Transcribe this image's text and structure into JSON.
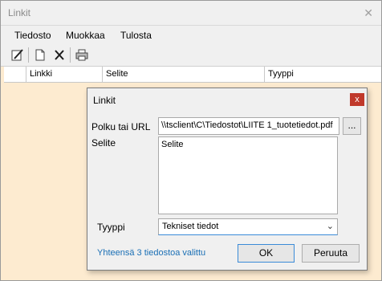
{
  "window": {
    "title": "Linkit",
    "close_glyph": "✕"
  },
  "menu": {
    "items": [
      "Tiedosto",
      "Muokkaa",
      "Tulosta"
    ]
  },
  "toolbar": {
    "icons": [
      "edit-icon",
      "new-document-icon",
      "delete-icon",
      "print-icon"
    ]
  },
  "grid": {
    "columns": [
      "Linkki",
      "Selite",
      "Tyyppi"
    ]
  },
  "dialog": {
    "title": "Linkit",
    "close_glyph": "x",
    "path_label": "Polku tai URL",
    "path_value": "\\\\tsclient\\C\\Tiedostot\\LIITE 1_tuotetiedot.pdf",
    "browse_label": "...",
    "desc_label": "Selite",
    "desc_value": "Selite",
    "type_label": "Tyyppi",
    "type_value": "Tekniset tiedot",
    "status_text": "Yhteensä 3 tiedostoa valittu",
    "ok_label": "OK",
    "cancel_label": "Peruuta"
  },
  "colors": {
    "background": "#fdebd0",
    "close_red": "#c0392b",
    "link_blue": "#1a6fb5",
    "focus_blue": "#3a8bd8"
  }
}
